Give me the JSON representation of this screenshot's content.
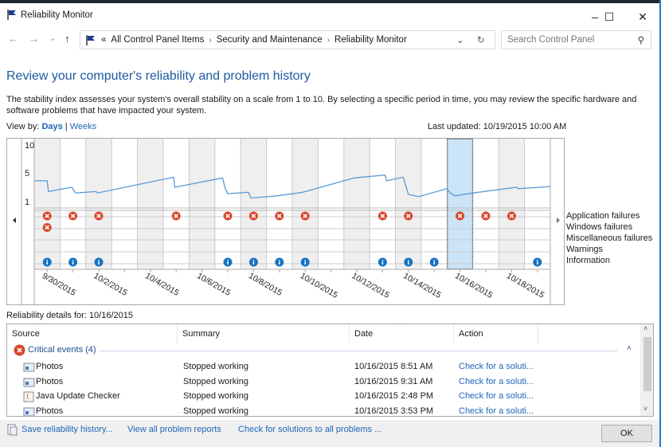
{
  "window": {
    "title": "Reliability Monitor",
    "minimize": "–",
    "maximize": "☐",
    "close": "✕"
  },
  "nav": {
    "back": "←",
    "forward": "→",
    "recent": "⌄",
    "up": "↑",
    "breadcrumb_prefix": "«",
    "breadcrumb": [
      "All Control Panel Items",
      "Security and Maintenance",
      "Reliability Monitor"
    ],
    "separator": "›",
    "dropdown": "⌄",
    "refresh": "↻",
    "search_placeholder": "Search Control Panel",
    "search_icon": "⚲"
  },
  "heading": "Review your computer's reliability and problem history",
  "description": "The stability index assesses your system's overall stability on a scale from 1 to 10. By selecting a specific period in time, you may review the specific hardware and software problems that have impacted your system.",
  "view_by": {
    "label": "View by:",
    "days": "Days",
    "divider": "|",
    "weeks": "Weeks"
  },
  "last_updated": "Last updated: 10/19/2015 10:00 AM",
  "chart_data": {
    "type": "line",
    "y_ticks": [
      "10",
      "5",
      "1"
    ],
    "ylim": [
      1,
      10
    ],
    "dates": [
      "9/30/2015",
      "10/1/2015",
      "10/2/2015",
      "10/3/2015",
      "10/4/2015",
      "10/5/2015",
      "10/6/2015",
      "10/7/2015",
      "10/8/2015",
      "10/9/2015",
      "10/10/2015",
      "10/11/2015",
      "10/12/2015",
      "10/13/2015",
      "10/14/2015",
      "10/15/2015",
      "10/16/2015",
      "10/17/2015",
      "10/18/2015",
      "10/19/2015"
    ],
    "date_labels": [
      "9/30/2015",
      "10/2/2015",
      "10/4/2015",
      "10/6/2015",
      "10/8/2015",
      "10/10/2015",
      "10/12/2015",
      "10/14/2015",
      "10/16/2015",
      "10/18/2015"
    ],
    "selected_date": "10/16/2015",
    "stability_index": [
      [
        0,
        3.9
      ],
      [
        0.5,
        3.9
      ],
      [
        0.55,
        2.4
      ],
      [
        1.45,
        3.0
      ],
      [
        1.6,
        2.2
      ],
      [
        2.4,
        2.4
      ],
      [
        2.45,
        2.2
      ],
      [
        5.4,
        4.4
      ],
      [
        5.45,
        3.0
      ],
      [
        7.3,
        4.3
      ],
      [
        7.4,
        2.8
      ],
      [
        7.5,
        2.1
      ],
      [
        8.3,
        2.3
      ],
      [
        8.4,
        1.5
      ],
      [
        9.4,
        1.8
      ],
      [
        10.4,
        2.3
      ],
      [
        12.4,
        4.3
      ],
      [
        13.6,
        4.7
      ],
      [
        13.65,
        3.9
      ],
      [
        14.3,
        4.4
      ],
      [
        14.5,
        2.0
      ],
      [
        14.9,
        1.7
      ],
      [
        16.0,
        2.8
      ],
      [
        16.1,
        2.3
      ],
      [
        16.3,
        1.8
      ],
      [
        17.0,
        2.2
      ],
      [
        18.7,
        3.0
      ],
      [
        18.75,
        2.8
      ],
      [
        20.0,
        3.1
      ]
    ],
    "rows": [
      "Application failures",
      "Windows failures",
      "Miscellaneous failures",
      "Warnings",
      "Information"
    ],
    "application_failures": {
      "9/30/2015": 2,
      "10/1/2015": 1,
      "10/2/2015": 1,
      "10/5/2015": 1,
      "10/7/2015": 1,
      "10/8/2015": 1,
      "10/9/2015": 1,
      "10/10/2015": 1,
      "10/13/2015": 1,
      "10/14/2015": 1,
      "10/16/2015": 1,
      "10/17/2015": 1,
      "10/18/2015": 1
    },
    "information_events": [
      "9/30/2015",
      "10/1/2015",
      "10/2/2015",
      "10/7/2015",
      "10/8/2015",
      "10/9/2015",
      "10/10/2015",
      "10/13/2015",
      "10/14/2015",
      "10/15/2015",
      "10/19/2015"
    ],
    "line_color": "#5b9bd5",
    "error_color": "#d9472b",
    "info_color": "#1672c4",
    "selection_color": "#cce4f7"
  },
  "details": {
    "label": "Reliability details for: 10/16/2015",
    "columns": [
      "Source",
      "Summary",
      "Date",
      "Action"
    ],
    "group": "Critical events (4)",
    "rows": [
      {
        "source": "Photos",
        "summary": "Stopped working",
        "date": "10/16/2015 8:51 AM",
        "action": "Check for a soluti..."
      },
      {
        "source": "Photos",
        "summary": "Stopped working",
        "date": "10/16/2015 9:31 AM",
        "action": "Check for a soluti..."
      },
      {
        "source": "Java Update Checker",
        "summary": "Stopped working",
        "date": "10/16/2015 2:48 PM",
        "action": "Check for a soluti..."
      },
      {
        "source": "Photos",
        "summary": "Stopped working",
        "date": "10/16/2015 3:53 PM",
        "action": "Check for a soluti..."
      }
    ]
  },
  "footer": {
    "save": "Save reliability history...",
    "view_all": "View all problem reports",
    "check_all": "Check for solutions to all problems ...",
    "ok": "OK"
  }
}
